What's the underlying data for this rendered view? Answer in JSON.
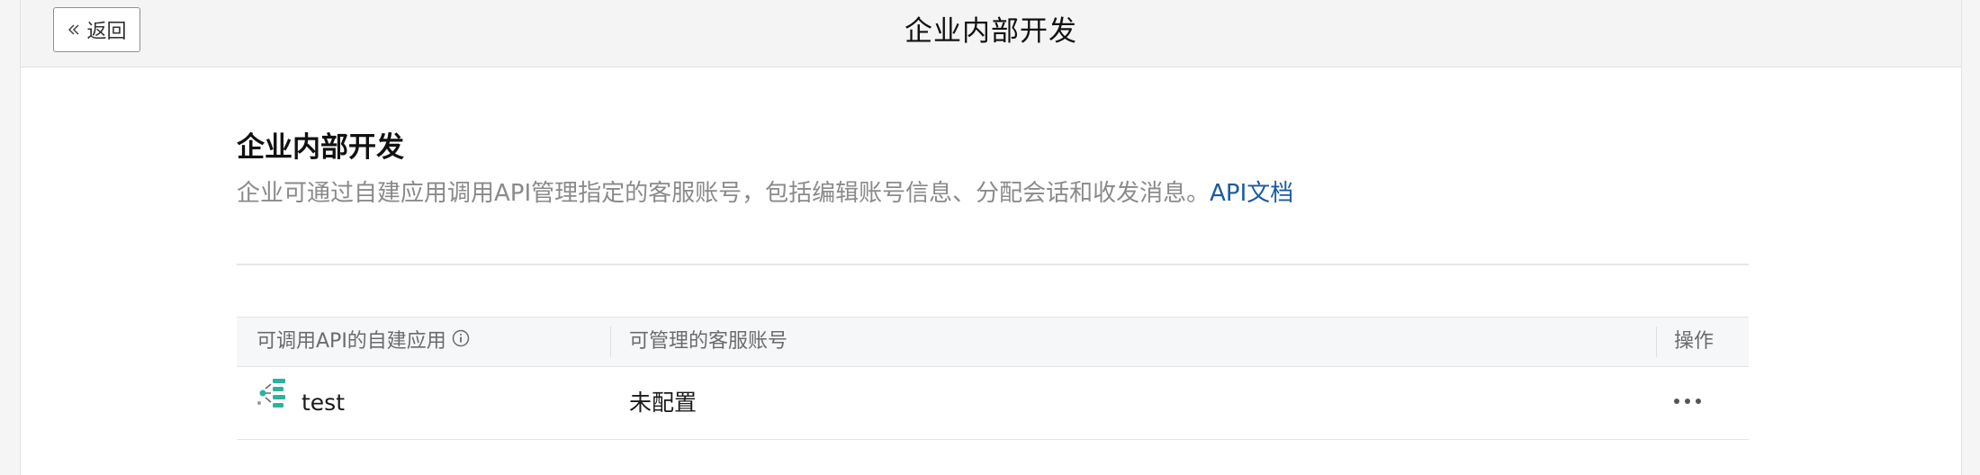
{
  "topbar": {
    "back_label": "返回",
    "title": "企业内部开发"
  },
  "section": {
    "title": "企业内部开发",
    "description": "企业可通过自建应用调用API管理指定的客服账号，包括编辑账号信息、分配会话和收发消息。",
    "doc_link": "API文档"
  },
  "table": {
    "columns": [
      "可调用API的自建应用",
      "可管理的客服账号",
      "操作"
    ],
    "rows": [
      {
        "app_icon": "app-logo-icon",
        "app_name": "test",
        "accounts": "未配置",
        "actions_icon": "more-icon"
      }
    ]
  },
  "colors": {
    "link": "#1a5aa0",
    "app_icon_teal": "#2bb3a0"
  }
}
